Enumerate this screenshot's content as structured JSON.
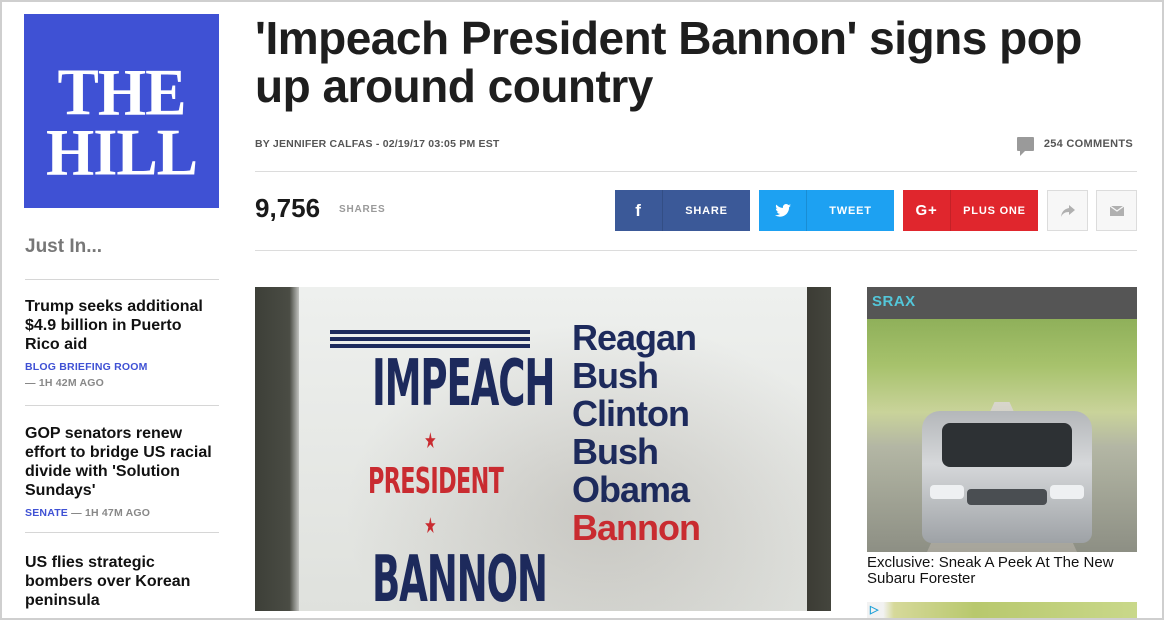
{
  "logo": {
    "line1": "THE",
    "line2": "HILL"
  },
  "sidebar": {
    "heading": "Just In...",
    "items": [
      {
        "headline": "Trump seeks additional $4.9 billion in Puerto Rico aid",
        "category": "BLOG BRIEFING ROOM",
        "time": "— 1H 42M AGO"
      },
      {
        "headline": "GOP senators renew effort to bridge US racial divide with 'Solution Sundays'",
        "category": "SENATE",
        "time": "— 1H 47M AGO"
      },
      {
        "headline": "US flies strategic bombers over Korean peninsula",
        "category": "",
        "time": ""
      }
    ]
  },
  "article": {
    "title": "'Impeach President Bannon' signs pop up around country",
    "byline": "BY JENNIFER CALFAS - 02/19/17 03:05 PM EST",
    "comments": "254 COMMENTS",
    "shares_count": "9,756",
    "shares_label": "SHARES"
  },
  "share_buttons": {
    "facebook": {
      "icon": "f",
      "label": "SHARE"
    },
    "twitter": {
      "icon": "t",
      "label": "TWEET"
    },
    "google": {
      "icon": "G+",
      "label": "PLUS ONE"
    }
  },
  "photo": {
    "left_line1": "IMPEACH",
    "left_line2": "PRESIDENT",
    "left_line3": "BANNON",
    "names": [
      "Reagan",
      "Bush",
      "Clinton",
      "Bush",
      "Obama",
      "Bannon"
    ]
  },
  "ad": {
    "brand": "SRAX",
    "caption": "Exclusive: Sneak A Peek At The New Subaru Forester",
    "adchoice": "▷"
  },
  "colors": {
    "brand_blue": "#3f51d4",
    "facebook": "#3b5998",
    "twitter": "#1da1f2",
    "google": "#e0262d"
  }
}
